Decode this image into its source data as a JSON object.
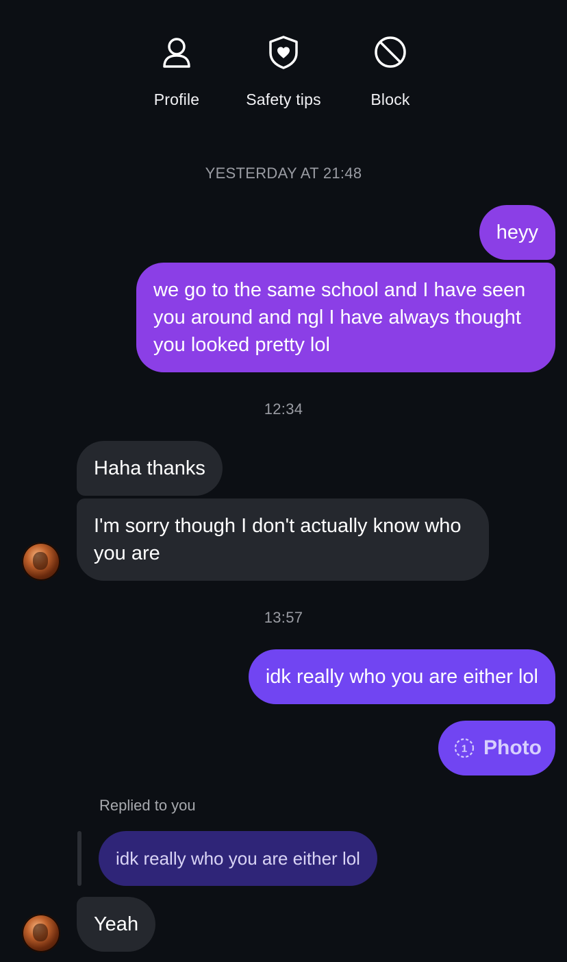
{
  "actions": [
    {
      "label": "Profile",
      "icon": "person-icon"
    },
    {
      "label": "Safety tips",
      "icon": "shield-heart-icon"
    },
    {
      "label": "Block",
      "icon": "block-icon"
    }
  ],
  "timestamps": {
    "first": "YESTERDAY AT 21:48",
    "second": "12:34",
    "third": "13:57"
  },
  "messages": {
    "m1": "heyy",
    "m2": "we go to the same school and I have seen you around and ngl I have always thought you looked pretty lol",
    "m3": "Haha thanks",
    "m4": "I'm sorry though I don't actually know who you are",
    "m5": "idk really who you are either lol",
    "m6": "Photo",
    "m8": "Yeah"
  },
  "photo_view_once_count": "1",
  "reply": {
    "label": "Replied to you",
    "quoted": "idk really who you are either lol"
  },
  "colors": {
    "background": "#0c0f14",
    "outgoing_violet": "#8b3fe6",
    "outgoing_indigo": "#7145f2",
    "incoming": "#25282e",
    "reply_quote": "#2f2578"
  }
}
